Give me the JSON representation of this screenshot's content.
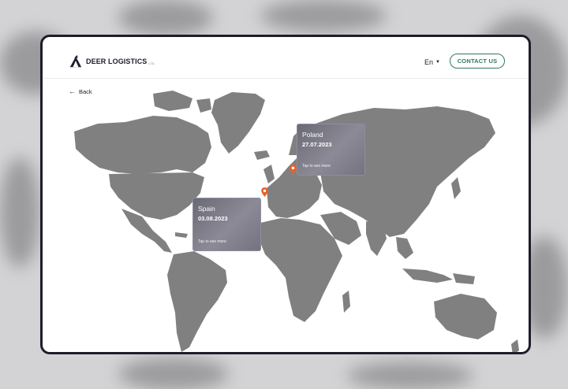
{
  "brand": {
    "name": "DEER LOGISTICS",
    "suffix": "LTD"
  },
  "header": {
    "language": "En",
    "contact_label": "CONTACT US"
  },
  "nav": {
    "back_label": "Back"
  },
  "map": {
    "pin_color": "#e8622a",
    "land_color": "#808080",
    "cards": [
      {
        "country": "Poland",
        "date": "27.07.2023",
        "cta": "Tap to see more"
      },
      {
        "country": "Spain",
        "date": "03.08.2023",
        "cta": "Tap to see more"
      }
    ]
  },
  "colors": {
    "accent": "#2f7a5a",
    "frame": "#1d1d2b"
  }
}
